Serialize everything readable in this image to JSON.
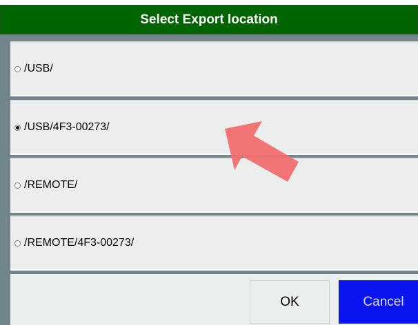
{
  "dialog": {
    "title": "Select Export location",
    "options": [
      {
        "label": "/USB/",
        "selected": false
      },
      {
        "label": "/USB/4F3-00273/",
        "selected": true
      },
      {
        "label": "/REMOTE/",
        "selected": false
      },
      {
        "label": "/REMOTE/4F3-00273/",
        "selected": false
      }
    ],
    "buttons": {
      "ok_label": "OK",
      "cancel_label": "Cancel"
    }
  },
  "colors": {
    "title_bar": "#006400",
    "cancel_button": "#0a14ee",
    "annotation_arrow": "#f26e6e"
  },
  "annotation": {
    "icon": "pointer-arrow-icon"
  }
}
